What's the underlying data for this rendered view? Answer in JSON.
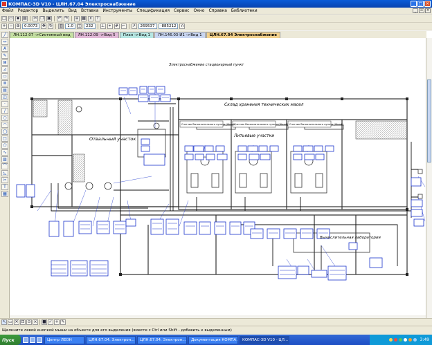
{
  "window": {
    "title": "КОМПАС-3D V10 - ЦЛН.67.04 Электроснабжение"
  },
  "menu": [
    "Файл",
    "Редактор",
    "Выделить",
    "Вид",
    "Вставка",
    "Инструменты",
    "Спецификация",
    "Сервис",
    "Окно",
    "Справка",
    "Библиотеки"
  ],
  "toolbar": {
    "zoom_value": "0.0073",
    "scale_value": "1.0",
    "layer_value": "232",
    "coord_x": "269537",
    "coord_y": "-885212"
  },
  "tabs": [
    "ЛН.112.07 ->Системный вид",
    "ЛН.112.09 ->Вид 5",
    "План ->Вид 1",
    "ЛН.146.03-И1 ->Вид 1",
    "ЦЛН.67.04 Электроснабжение"
  ],
  "drawing": {
    "labels": {
      "top_caption": "Электроснабжение стационарный пункт",
      "room_top_right": "Склад хранения технических масел",
      "room_left": "Отвальный участок",
      "room_center": "Литьевые участки",
      "room_lower": "Вычислительная лаборатория",
      "block_a": "Счетчик Вычислительного пункта (Шкаф)",
      "block_b": "Счетчик Вычислительного пункта (Шкаф)",
      "block_c": "Счетчик Вычислительного пункта (Шкаф)"
    },
    "colors": {
      "line": "#000000",
      "tag": "#1a33cc",
      "wall": "#333333"
    }
  },
  "status": {
    "hint": "Щелкните левой кнопкой мыши на объекте для его выделения (вместе с Ctrl или Shift - добавить к выделенным)"
  },
  "taskbar": {
    "start": "Пуск",
    "tasks": [
      "Центр ЛЕОН",
      "ЦЛН.67.04. Электрон...",
      "ЦЛН.67.04. Электрон...",
      "Документация КОМПА...",
      "КОМПАС-3D V10 - ЦЛ..."
    ],
    "clock": "3:49"
  }
}
